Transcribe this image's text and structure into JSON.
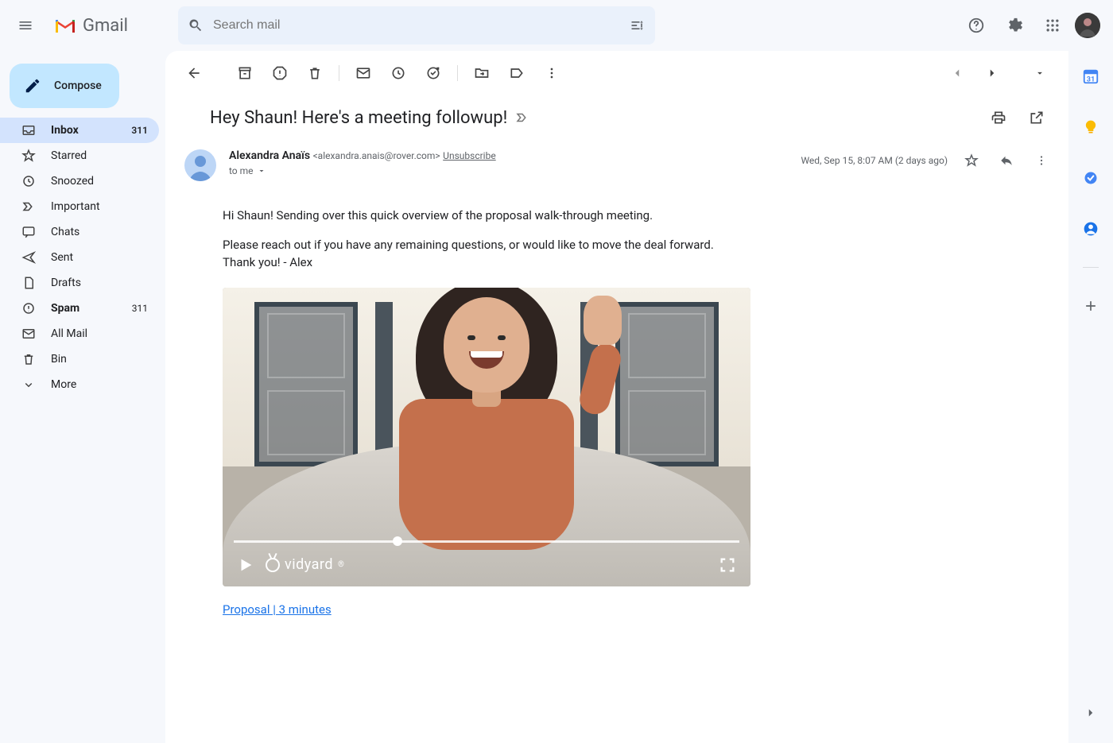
{
  "header": {
    "app_name": "Gmail",
    "search_placeholder": "Search mail"
  },
  "compose_label": "Compose",
  "sidebar": {
    "items": [
      {
        "icon": "inbox",
        "label": "Inbox",
        "count": "311",
        "active": true
      },
      {
        "icon": "star",
        "label": "Starred"
      },
      {
        "icon": "clock",
        "label": "Snoozed"
      },
      {
        "icon": "important",
        "label": "Important"
      },
      {
        "icon": "chat",
        "label": "Chats"
      },
      {
        "icon": "send",
        "label": "Sent"
      },
      {
        "icon": "draft",
        "label": "Drafts"
      },
      {
        "icon": "spam",
        "label": "Spam",
        "count": "311"
      },
      {
        "icon": "allmail",
        "label": "All Mail"
      },
      {
        "icon": "bin",
        "label": "Bin"
      },
      {
        "icon": "more",
        "label": "More"
      }
    ]
  },
  "email": {
    "subject": "Hey Shaun! Here's a meeting followup!",
    "sender_name": "Alexandra Anaïs",
    "sender_email": "<alexandra.anais@rover.com>",
    "unsubscribe": "Unsubscribe",
    "to_line": "to me",
    "date": "Wed, Sep 15, 8:07 AM (2 days ago)",
    "body_line1": "Hi Shaun! Sending over this quick overview of the proposal walk-through meeting.",
    "body_line2": "Please reach out if you have any remaining questions, or would like to move the deal forward.",
    "body_line3": "Thank you! - Alex",
    "video_brand": "vidyard",
    "video_link_text": "Proposal | 3 minutes"
  }
}
